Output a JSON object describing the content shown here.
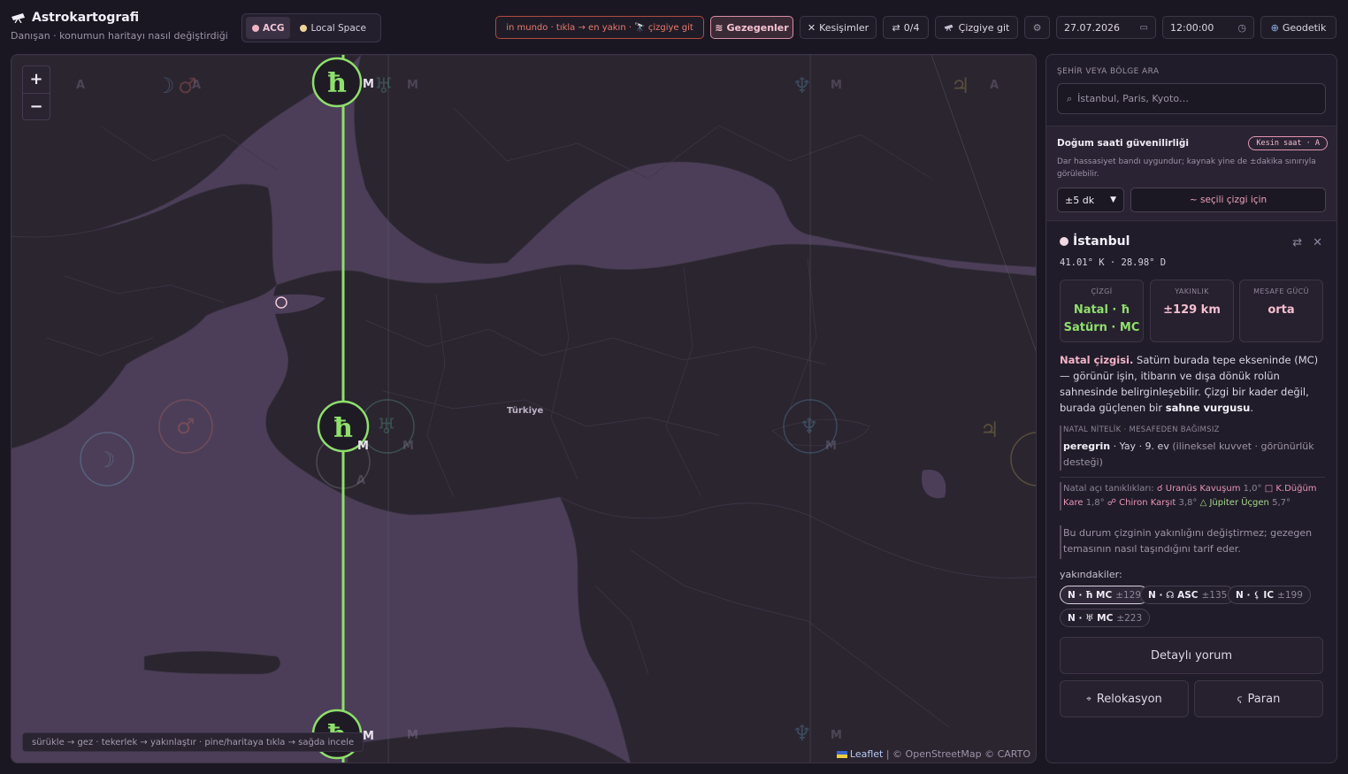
{
  "app": {
    "title": "Astrokartografi",
    "subtitle": "Danışan · konumun haritayı nasıl değiştirdiği"
  },
  "modes": [
    {
      "label": "ACG",
      "active": true
    },
    {
      "label": "Local Space",
      "active": false
    }
  ],
  "toolbar": {
    "hint": "in mundo · tıkla → en yakın · 🔭 çizgiye git",
    "planets_label": "Gezegenler",
    "crossings_label": "Kesişimler",
    "counter_label": "0/4",
    "goto_line_label": "Çizgiye git",
    "date_value": "27.07.2026",
    "time_value": "12:00:00",
    "geodetic_label": "Geodetik"
  },
  "map": {
    "country_label": "Türkiye",
    "hint": "sürükle → gez · tekerlek → yakınlaştır · pine/haritaya tıkla → sağda incele",
    "attribution_leaflet": "Leaflet",
    "attribution_rest": "| © OpenStreetMap © CARTO",
    "zoom_in": "+",
    "zoom_out": "−",
    "line_label_saturn": "ħ",
    "line_suffix": "M",
    "ghost_suffix_a": "A",
    "ghost_suffix_m": "M"
  },
  "panel": {
    "search_label": "ŞEHİR VEYA BÖLGE ARA",
    "search_placeholder": "İstanbul, Paris, Kyoto…",
    "reliability_title": "Doğum saati güvenilirliği",
    "reliability_badge": "Kesin saat · A",
    "reliability_desc": "Dar hassasiyet bandı uygundur; kaynak yine de ±dakika sınırıyla görülebilir.",
    "tolerance_value": "±5 dk",
    "tolerance_note": "~ seçili çizgi için",
    "location": {
      "name": "İstanbul",
      "coords": "41.01° K · 28.98° D"
    },
    "stats": [
      {
        "label": "ÇİZGİ",
        "value_line1": "Natal · ħ",
        "value_line2": "Satürn · MC"
      },
      {
        "label": "YAKINLIK",
        "value": "±129 km"
      },
      {
        "label": "MESAFE GÜCÜ",
        "value": "orta"
      }
    ],
    "description": {
      "lead": "Natal çizgisi.",
      "text_a": " Satürn burada tepe ekseninde (MC) — görünür işin, itibarın ve dışa dönük rolün sahnesinde belirginleşebilir. Çizgi bir kader değil, burada güçlenen bir ",
      "emphasis": "sahne vurgusu",
      "text_b": "."
    },
    "quality": {
      "caption": "NATAL NİTELİK · MESAFEDEN BAĞIMSIZ",
      "strong": "peregrin",
      "plain": " · Yay · 9. ev",
      "muted": " (ilineksel kuvvet · görünürlük desteği)"
    },
    "aspects": {
      "prefix": "Natal açı tanıklıkları:",
      "items": [
        {
          "label": "☌ Uranüs Kavuşum",
          "deg": "1,0°",
          "tone": "pink"
        },
        {
          "label": "□ K.Düğüm Kare",
          "deg": "1,8°",
          "tone": "pink"
        },
        {
          "label": "☍ Chiron Karşıt",
          "deg": "3,8°",
          "tone": "pink"
        },
        {
          "label": "△ Jüpiter Üçgen",
          "deg": "5,7°",
          "tone": "green"
        }
      ]
    },
    "note": "Bu durum çizginin yakınlığını değiştirmez; gezegen temasının nasıl taşındığını tarif eder.",
    "nearby_label": "yakındakiler:",
    "nearby": [
      {
        "label": "N · ħ MC",
        "dist": "±129",
        "active": true
      },
      {
        "label": "N · ☊ ASC",
        "dist": "±135",
        "active": false
      },
      {
        "label": "N · ⚸ IC",
        "dist": "±199",
        "active": false
      },
      {
        "label": "N · ♅ MC",
        "dist": "±223",
        "active": false
      }
    ],
    "detail_button": "Detaylı yorum",
    "relocation_button": "Relokasyon",
    "paran_button": "Paran"
  },
  "colors": {
    "accent_pink": "#f2bfd0",
    "line_green": "#8fdf6c",
    "hint_red": "#ea7a6c",
    "land": "#2b2530",
    "sea": "#4c3e58"
  }
}
